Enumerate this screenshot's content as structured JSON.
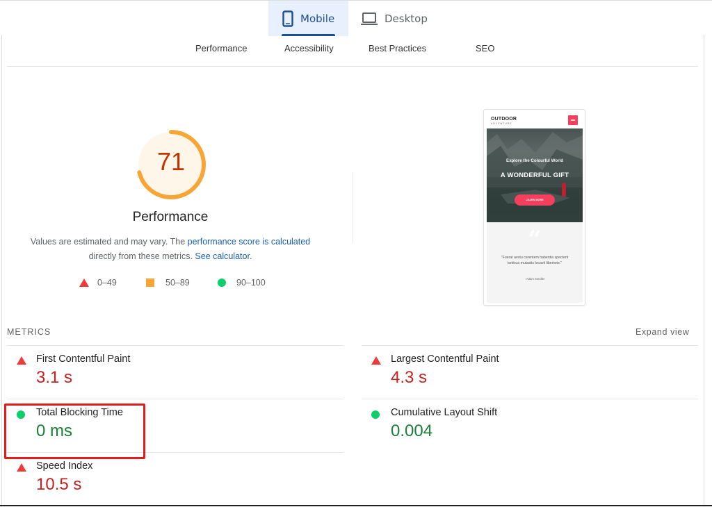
{
  "device_tabs": [
    {
      "label": "Mobile",
      "icon": "mobile-phone-icon",
      "selected": true
    },
    {
      "label": "Desktop",
      "icon": "laptop-icon",
      "selected": false
    }
  ],
  "category_tabs": [
    {
      "label": "Performance"
    },
    {
      "label": "Accessibility"
    },
    {
      "label": "Best Practices"
    },
    {
      "label": "SEO"
    }
  ],
  "score": {
    "value": "71",
    "fraction": 0.71,
    "title": "Performance",
    "color": "#f7a636",
    "text_color": "#c33300"
  },
  "description": {
    "text1": "Values are estimated and may vary. The ",
    "link1": "performance score is calculated",
    "text2": " directly from these metrics. ",
    "link2": "See calculator",
    "text3": "."
  },
  "legend": [
    {
      "shape": "triangle",
      "range": "0–49",
      "color": "#eb3b3b"
    },
    {
      "shape": "square",
      "range": "50–89",
      "color": "#f7a636"
    },
    {
      "shape": "circle",
      "range": "90–100",
      "color": "#0cce6b"
    }
  ],
  "preview": {
    "logo": "OUTDOOR",
    "logo_sub": "ADVENTURE",
    "hero_subtitle": "Explore the Colourful World",
    "hero_title": "A WONDERFUL GIFT",
    "button": "LEARN MORE",
    "quote_mark": "“",
    "quote": "\"Fuerat aestu carentem habentia spectent tonitrua mutastis locavit liberioris.\"",
    "author": "- Adam Sendler"
  },
  "metrics": {
    "section_label": "METRICS",
    "expand_label": "Expand view",
    "items": [
      {
        "title": "First Contentful Paint",
        "value": "3.1 s",
        "status": "fail"
      },
      {
        "title": "Largest Contentful Paint",
        "value": "4.3 s",
        "status": "fail"
      },
      {
        "title": "Total Blocking Time",
        "value": "0 ms",
        "status": "pass",
        "highlighted": true
      },
      {
        "title": "Cumulative Layout Shift",
        "value": "0.004",
        "status": "pass"
      },
      {
        "title": "Speed Index",
        "value": "10.5 s",
        "status": "fail"
      }
    ]
  },
  "colors": {
    "accent": "#1a4f9c",
    "fail": "#c5221f",
    "pass": "#188038",
    "highlight_box": "#e31b1b"
  }
}
